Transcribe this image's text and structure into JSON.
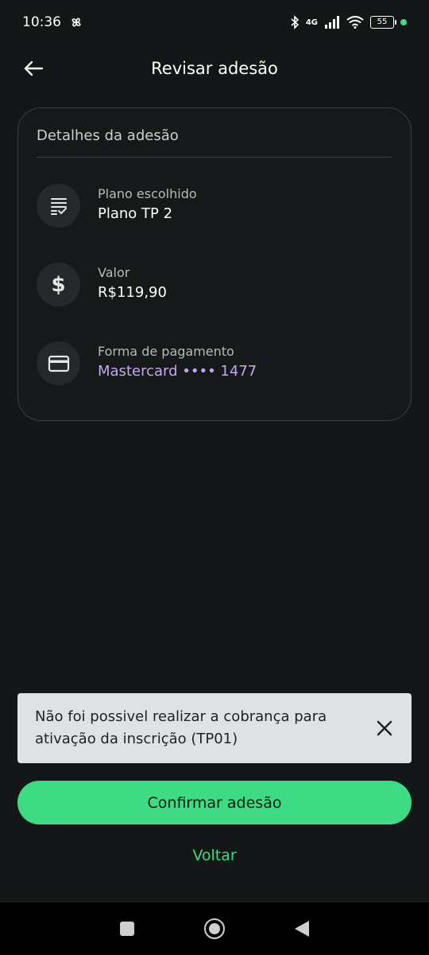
{
  "status_bar": {
    "time": "10:36",
    "network": "4G",
    "battery": "55",
    "icons": [
      "pinwheel-icon",
      "bluetooth-icon",
      "signal-icon",
      "wifi-icon",
      "battery-icon",
      "notification-dot-icon"
    ]
  },
  "header": {
    "title": "Revisar adesão",
    "back_icon": "arrow-left-icon"
  },
  "details": {
    "title": "Detalhes da adesão",
    "items": [
      {
        "label": "Plano escolhido",
        "value": "Plano TP 2",
        "icon": "list-check-icon"
      },
      {
        "label": "Valor",
        "value": "R$119,90",
        "icon": "dollar-icon"
      },
      {
        "label": "Forma de pagamento",
        "value": "Mastercard •••• 1477",
        "icon": "credit-card-icon"
      }
    ]
  },
  "snackbar": {
    "message": "Não foi possivel realizar a cobrança para ativação da inscrição (TP01)",
    "close_icon": "close-icon"
  },
  "actions": {
    "confirm_label": "Confirmar adesão",
    "back_label": "Voltar"
  },
  "colors": {
    "background": "#141718",
    "accent_green": "#3ddc84",
    "payment_text": "#c9a6f0",
    "snackbar_bg": "#dfe2e3"
  }
}
